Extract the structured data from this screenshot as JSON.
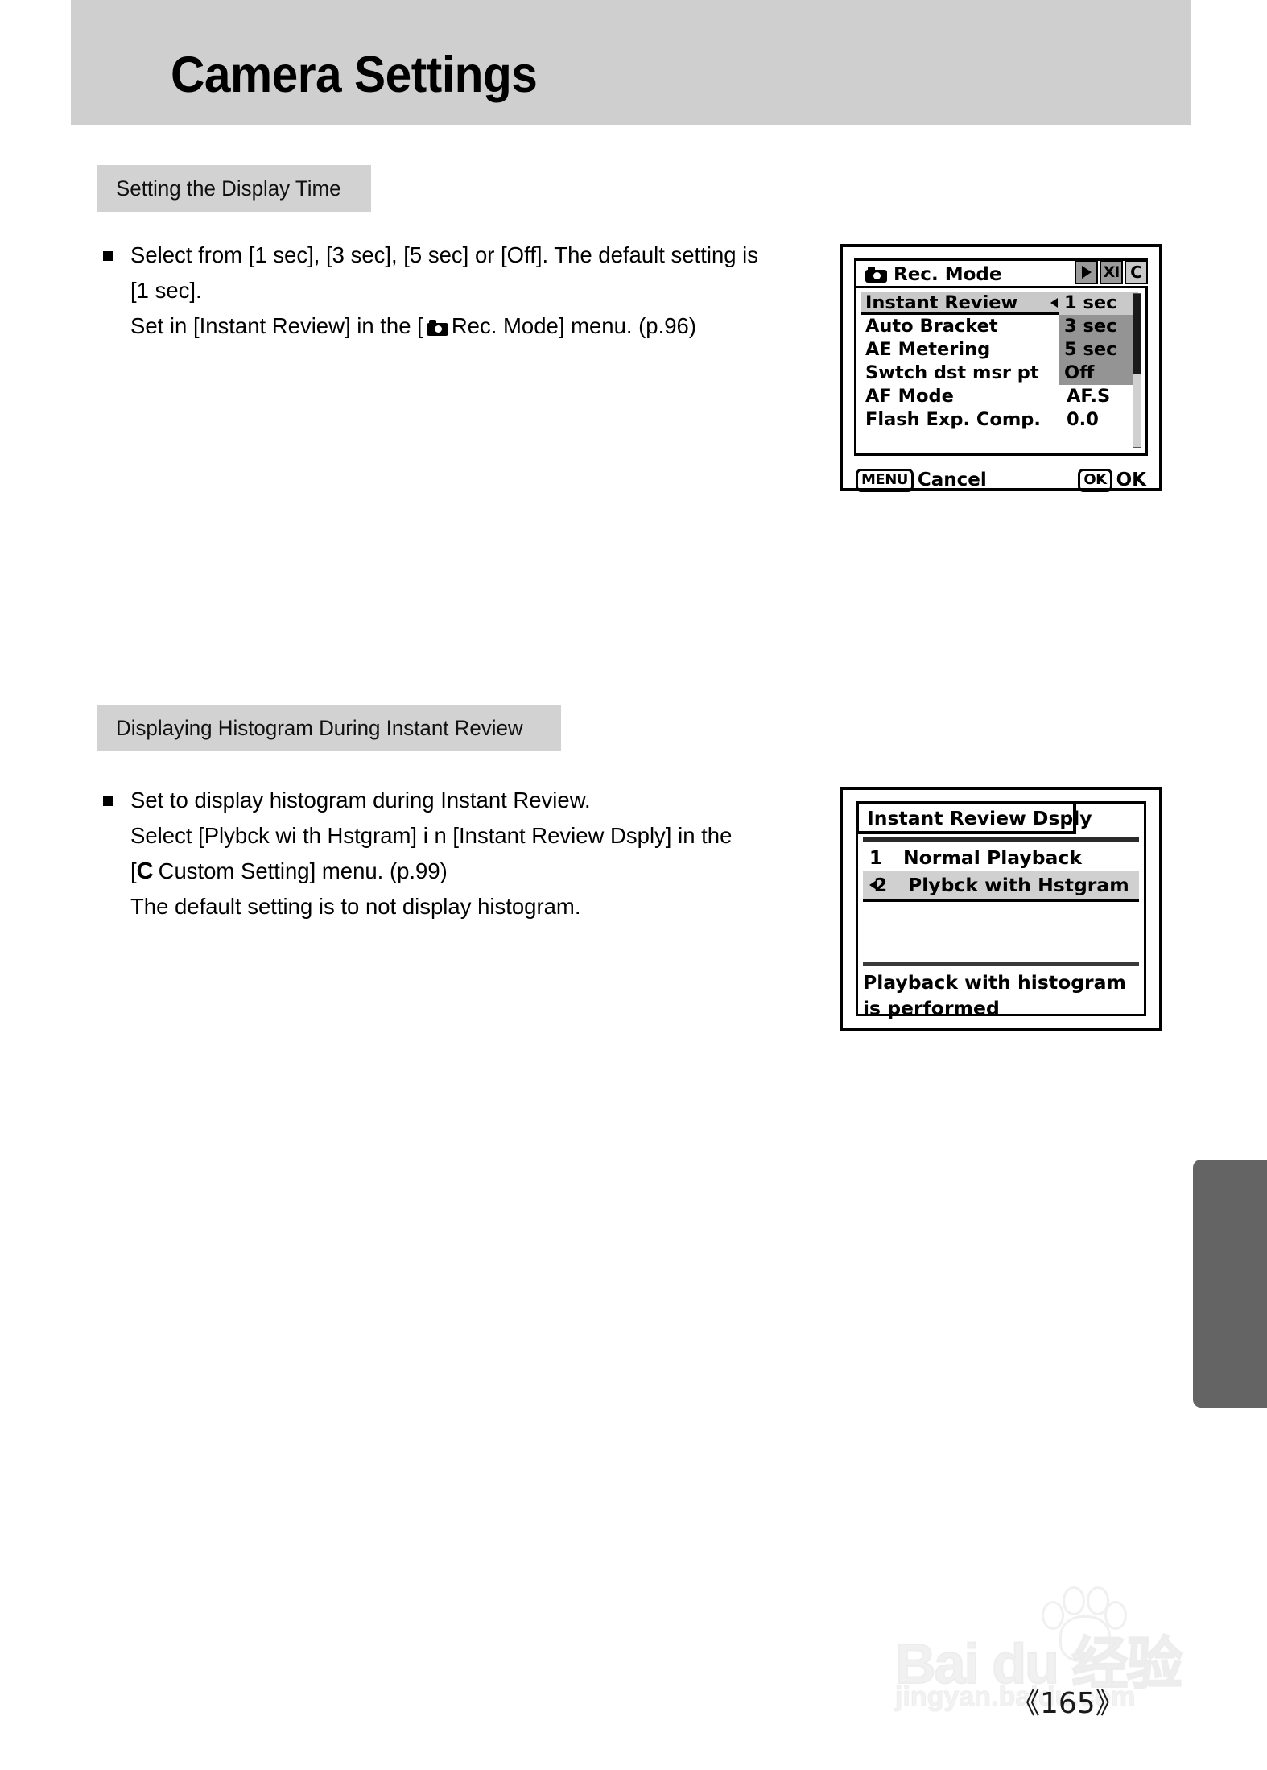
{
  "page": {
    "title": "Camera Settings",
    "page_number": "《165》"
  },
  "sections": [
    {
      "heading": "Setting the Display Time",
      "paragraph_lines": [
        "Select from [1 sec], [3 sec], [5 sec] or [Off]. The default setting is",
        "[1 sec].",
        "Set in [Instant Review] in the [",
        "Rec. Mode] menu. (p.96)"
      ]
    },
    {
      "heading": "Displaying Histogram During Instant Review",
      "paragraph_lines": [
        "Set to display histogram during Instant Review.",
        "Select [Plybck wi th Hstgram] i n [Instant Review Dsply] in the",
        "[",
        "Custom Setting] menu. (p.99)",
        "The default setting is to not display histogram."
      ],
      "custom_glyph": "C"
    }
  ],
  "lcd_rec_mode": {
    "title": "Rec. Mode",
    "tab_icons": [
      "playback-icon",
      "setup-tools-icon",
      "custom-c-icon"
    ],
    "tab_icon_labels": [
      "",
      "XI",
      "C"
    ],
    "menu_items": [
      {
        "label": "Instant Review",
        "value": "1 sec",
        "selected": true
      },
      {
        "label": "Auto Bracket",
        "value": ""
      },
      {
        "label": "AE Metering",
        "value": ""
      },
      {
        "label": "Swtch dst msr pt",
        "value": ""
      },
      {
        "label": "AF Mode",
        "value": "AF.S"
      },
      {
        "label": "Flash Exp. Comp.",
        "value": "0.0"
      }
    ],
    "dropdown": {
      "options": [
        "1 sec",
        "3 sec",
        "5 sec",
        "Off"
      ],
      "current": "1 sec"
    },
    "footer": {
      "menu_key": "MENU",
      "menu_action": "Cancel",
      "ok_key": "OK",
      "ok_action": "OK"
    }
  },
  "lcd_instant_review_dsply": {
    "title": "Instant Review Dsply",
    "options": [
      {
        "num": "1",
        "label": "Normal Playback",
        "selected": false
      },
      {
        "num": "2",
        "label": "Plybck with Hstgram",
        "selected": true
      }
    ],
    "description_lines": [
      "Playback with histogram",
      "is performed"
    ]
  },
  "watermark": {
    "brand": "Bai du 经验",
    "url": "jingyan.baidu.com"
  },
  "colors": {
    "banner": "#cfcfcf",
    "section_header": "#d2d2d2",
    "edge_tab": "#646464",
    "lcd_highlight": "#c9c9c9",
    "lcd_dropdown": "#949494"
  }
}
